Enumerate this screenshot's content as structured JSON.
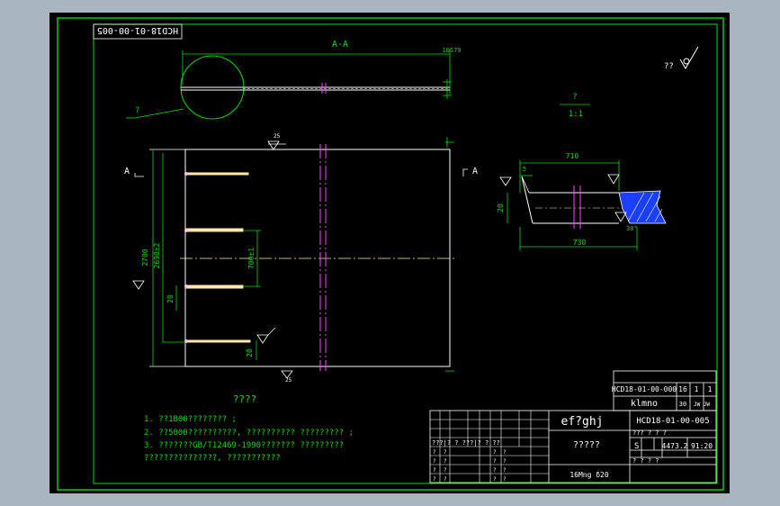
{
  "drawing_code_top": "HCD18-01-00-005",
  "section_label": "A-A",
  "section_dim": "10579",
  "leader_q": "?",
  "roughness_corner": "??",
  "scale_label_q": "?",
  "scale_value": "1:1",
  "view_marker_left": "A",
  "view_marker_right": "A",
  "roughness_25": "25",
  "dim_2700": "2700",
  "dim_2690": "2690±2",
  "dim_700": "700±1",
  "dim_20a": "20",
  "dim_20b": "20",
  "dim_25": "25",
  "dim_710": "710",
  "dim_5": "5",
  "dim_20_detail": "20",
  "dim_730": "730",
  "dim_30": "30°",
  "notes_title": "????",
  "notes": [
    "1. ??1B00???????? ;",
    "2. ??5000??????????, ??????????   ????????? ;",
    "3. ???????GB/T12469-1990???????   ?????????",
    "   ???????????????, ???????????"
  ],
  "tb_ref_code": "HCD18-01-00-000",
  "tb_ref_qty": "16",
  "tb_ref_n": "1",
  "tb_ref_n2": "1",
  "tb_ref_name": "klmno",
  "tb_ref_sm1": "30",
  "tb_ref_sm2": "JW JW",
  "tb_company": "ef?ghj",
  "tb_code": "HCD18-01-00-005",
  "tb_part_name": "?????",
  "tb_material": "16Mng  δ20",
  "tb_hdr_row": "???  ?   ?  ?",
  "tb_stage": "S",
  "tb_weight": "4473.2",
  "tb_scale": "91:20",
  "tb_sheet_row": "?       ?      ?    ?",
  "tb_grid_row": "???|?  ?   ???|?  ?  ??",
  "tb_q": "?"
}
